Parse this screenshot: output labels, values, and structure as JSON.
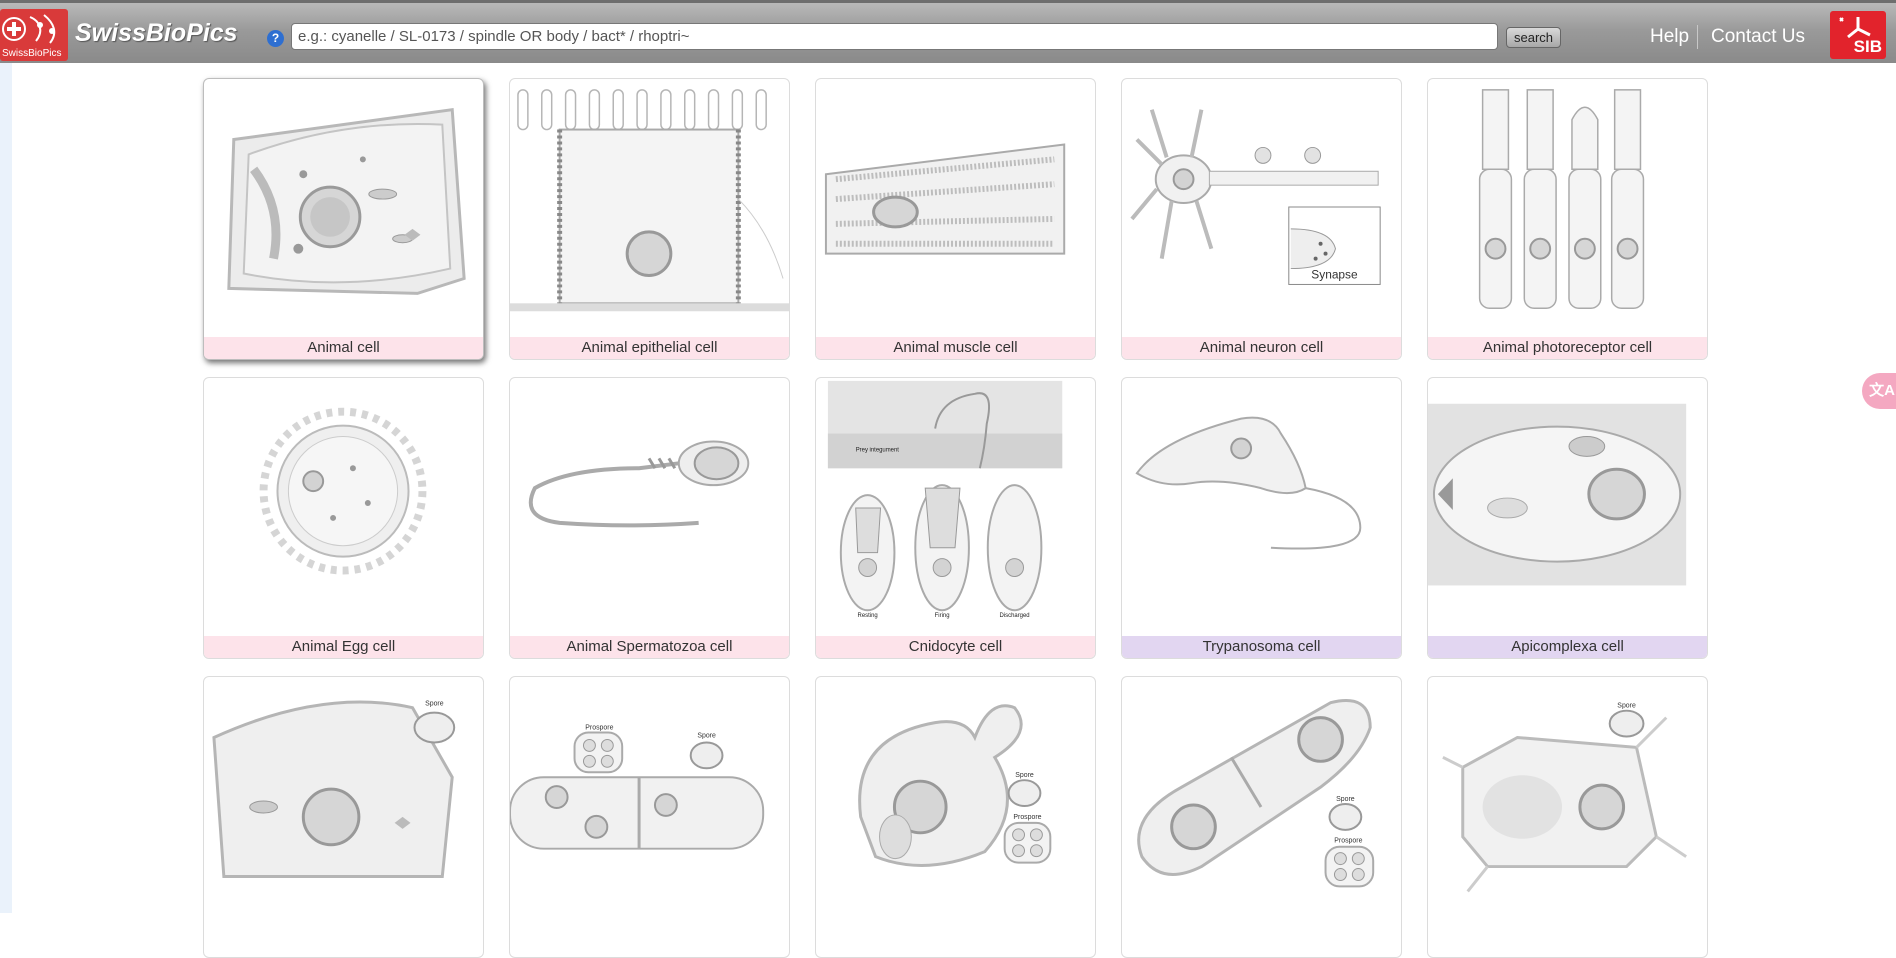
{
  "header": {
    "brand": "SwissBioPics",
    "logo_caption": "SwissBioPics",
    "help_icon": "?",
    "search_placeholder": "e.g.: cyanelle / SL-0173 / spindle OR body / bact* / rhoptri~",
    "search_button": "search",
    "nav": {
      "help": "Help",
      "contact": "Contact Us"
    },
    "sib_logo": "SIB"
  },
  "side_tab_icon": "translate-icon",
  "colors": {
    "label_animal": "#fde3ea",
    "label_protist": "#e2d6f1",
    "sib_red": "#e2232c"
  },
  "cards": [
    {
      "label": "Animal cell",
      "category": "animal"
    },
    {
      "label": "Animal epithelial cell",
      "category": "animal"
    },
    {
      "label": "Animal muscle cell",
      "category": "animal"
    },
    {
      "label": "Animal neuron cell",
      "category": "animal",
      "inset": "Synapse"
    },
    {
      "label": "Animal photoreceptor cell",
      "category": "animal"
    },
    {
      "label": "Animal Egg cell",
      "category": "animal"
    },
    {
      "label": "Animal Spermatozoa cell",
      "category": "animal"
    },
    {
      "label": "Cnidocyte cell",
      "category": "animal",
      "captions": [
        "Prey integument",
        "Resting",
        "Firing",
        "Discharged"
      ]
    },
    {
      "label": "Trypanosoma cell",
      "category": "protist"
    },
    {
      "label": "Apicomplexa cell",
      "category": "protist"
    },
    {
      "label": "",
      "category": "fungus",
      "captions": [
        "Spore"
      ]
    },
    {
      "label": "",
      "category": "fungus",
      "captions": [
        "Prospore",
        "Spore"
      ]
    },
    {
      "label": "",
      "category": "fungus",
      "captions": [
        "Spore",
        "Prospore"
      ]
    },
    {
      "label": "",
      "category": "fungus",
      "captions": [
        "Spore",
        "Prospore"
      ]
    },
    {
      "label": "",
      "category": "fungus",
      "captions": [
        "Spore"
      ]
    }
  ]
}
